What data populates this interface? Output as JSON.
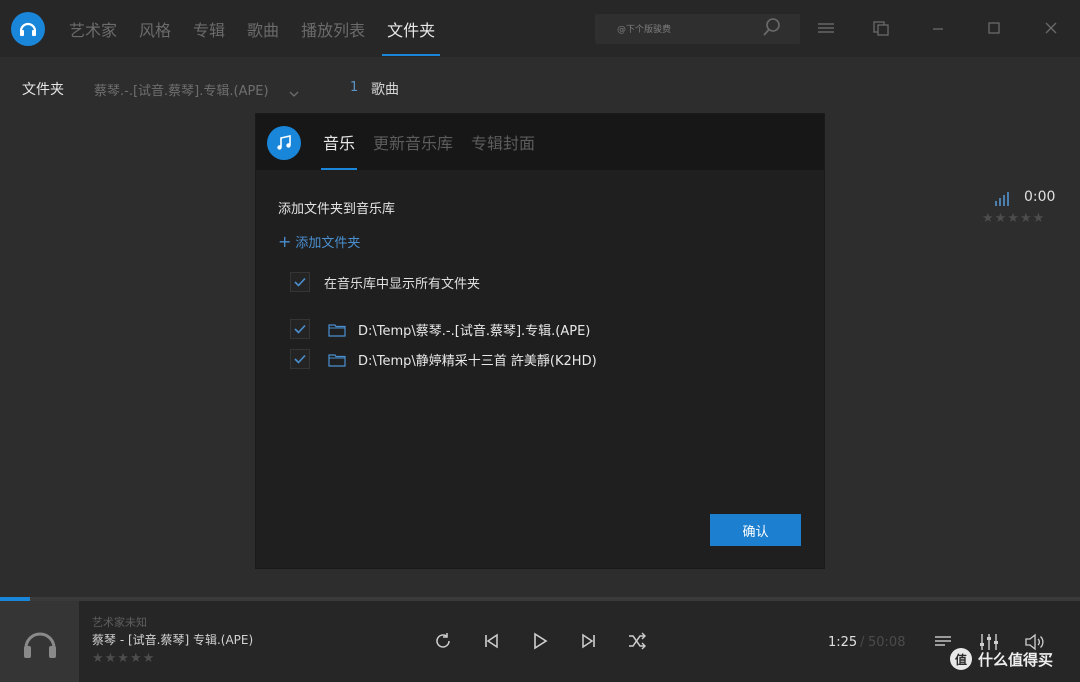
{
  "nav": {
    "tabs": [
      {
        "label": "艺术家"
      },
      {
        "label": "风格"
      },
      {
        "label": "专辑"
      },
      {
        "label": "歌曲"
      },
      {
        "label": "播放列表"
      },
      {
        "label": "文件夹",
        "active": true
      }
    ]
  },
  "search": {
    "text": "@下个版骏费"
  },
  "subheader": {
    "label": "文件夹",
    "current_folder": "蔡琴.-.[试音.蔡琴].专辑.(APE)",
    "count": "1",
    "songs_label": "歌曲"
  },
  "right_panel": {
    "time": "0:00",
    "stars": "★★★★★"
  },
  "dialog": {
    "tabs": [
      {
        "label": "音乐",
        "active": true
      },
      {
        "label": "更新音乐库"
      },
      {
        "label": "专辑封面"
      }
    ],
    "section_title": "添加文件夹到音乐库",
    "add_folder": "添加文件夹",
    "show_all_label": "在音乐库中显示所有文件夹",
    "folders": [
      {
        "path": "D:\\Temp\\蔡琴.-.[试音.蔡琴].专辑.(APE)"
      },
      {
        "path": "D:\\Temp\\静婷精采十三首 許美靜(K2HD)"
      }
    ],
    "confirm": "确认"
  },
  "player": {
    "artist": "艺术家未知",
    "title": "蔡琴 - [试音.蔡琴] 专辑.(APE)",
    "stars": "★★★★★",
    "current_time": "1:25",
    "separator": "/",
    "total_time": "50:08",
    "progress": 0.028
  },
  "watermark": {
    "badge": "值",
    "text": "什么值得买"
  },
  "colors": {
    "accent": "#1a86d9",
    "background": "#2d2d2e",
    "dialog": "#1f1f1f"
  }
}
